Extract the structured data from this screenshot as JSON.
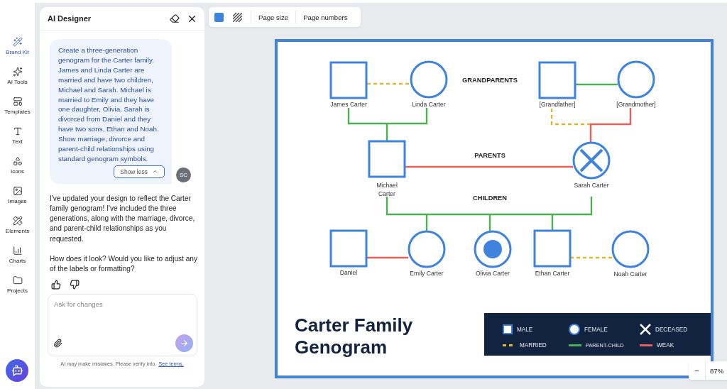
{
  "rail": {
    "items": [
      {
        "label": "Brand Kit",
        "kind": "brand",
        "selected": true
      },
      {
        "label": "AI Tools",
        "kind": "ai",
        "selected": false
      },
      {
        "label": "Templates",
        "kind": "templates",
        "selected": false
      },
      {
        "label": "Text",
        "kind": "text",
        "selected": false
      },
      {
        "label": "Icons",
        "kind": "icons",
        "selected": false
      },
      {
        "label": "Images",
        "kind": "images",
        "selected": false
      },
      {
        "label": "Elements",
        "kind": "elements",
        "selected": false
      },
      {
        "label": "Charts",
        "kind": "charts",
        "selected": false
      },
      {
        "label": "Projects",
        "kind": "projects",
        "selected": false
      }
    ]
  },
  "panel": {
    "title": "AI Designer",
    "user_message": "Create a three-generation genogram for the Carter family. James and Linda Carter are married and have two children, Michael and Sarah. Michael is married to Emily and they have one daughter, Olivia. Sarah is divorced from Daniel and they have two sons, Ethan and Noah. Show marriage, divorce and parent-child relationships using standard genogram symbols.",
    "show_less": "Show less",
    "avatar": "SC",
    "reply": [
      "I've updated your design to reflect the Carter family genogram! I've included the three generations, along with the marriage, divorce, and parent-child relationships as you requested.",
      "How does it look? Would you like to adjust any of the labels or formatting?"
    ],
    "input": {
      "placeholder": "Ask for changes"
    },
    "disclaimer": "AI may make mistakes. Please verify info.",
    "terms_link": "See terms."
  },
  "toolbar": {
    "items": [
      "Page size",
      "Page numbers"
    ]
  },
  "genogram": {
    "generations": [
      "GRANDPARENTS",
      "PARENTS",
      "CHILDREN"
    ],
    "people": [
      {
        "name": "James Carter",
        "kind": "male",
        "deceased": false,
        "highlighted": false
      },
      {
        "name": "Linda Carter",
        "kind": "female",
        "deceased": false,
        "highlighted": false
      },
      {
        "name": "[Grandfather]",
        "kind": "male",
        "deceased": false,
        "highlighted": false
      },
      {
        "name": "[Grandmother]",
        "kind": "female",
        "deceased": false,
        "highlighted": false
      },
      {
        "name": "Michael Carter",
        "kind": "male",
        "deceased": false,
        "highlighted": false
      },
      {
        "name": "Sarah Carter",
        "kind": "female",
        "deceased": true,
        "highlighted": false
      },
      {
        "name": "Daniel",
        "kind": "male",
        "deceased": false,
        "highlighted": false
      },
      {
        "name": "Emily Carter",
        "kind": "female",
        "deceased": false,
        "highlighted": false
      },
      {
        "name": "Olivia Carter",
        "kind": "female",
        "deceased": false,
        "highlighted": true
      },
      {
        "name": "Ethan Carter",
        "kind": "male",
        "deceased": false,
        "highlighted": false
      },
      {
        "name": "Noah Carter",
        "kind": "female",
        "deceased": false,
        "highlighted": false
      }
    ],
    "relationships": [
      {
        "kind": "married"
      },
      {
        "kind": "parent-child"
      },
      {
        "kind": "parent-child"
      },
      {
        "kind": "married"
      },
      {
        "kind": "weak"
      },
      {
        "kind": "weak"
      },
      {
        "kind": "parent-child"
      },
      {
        "kind": "weak"
      },
      {
        "kind": "married"
      }
    ],
    "title": "Carter Family Genogram",
    "legend": [
      {
        "kind": "male",
        "label": "MALE"
      },
      {
        "kind": "female",
        "label": "FEMALE"
      },
      {
        "kind": "deceased",
        "label": "DECEASED"
      },
      {
        "kind": "married",
        "label": "MARRIED"
      },
      {
        "kind": "parent-child",
        "label": "PARENT-CHILD"
      },
      {
        "kind": "weak",
        "label": "WEAK"
      }
    ]
  },
  "zoom": {
    "minus": "−",
    "value": "87%"
  }
}
